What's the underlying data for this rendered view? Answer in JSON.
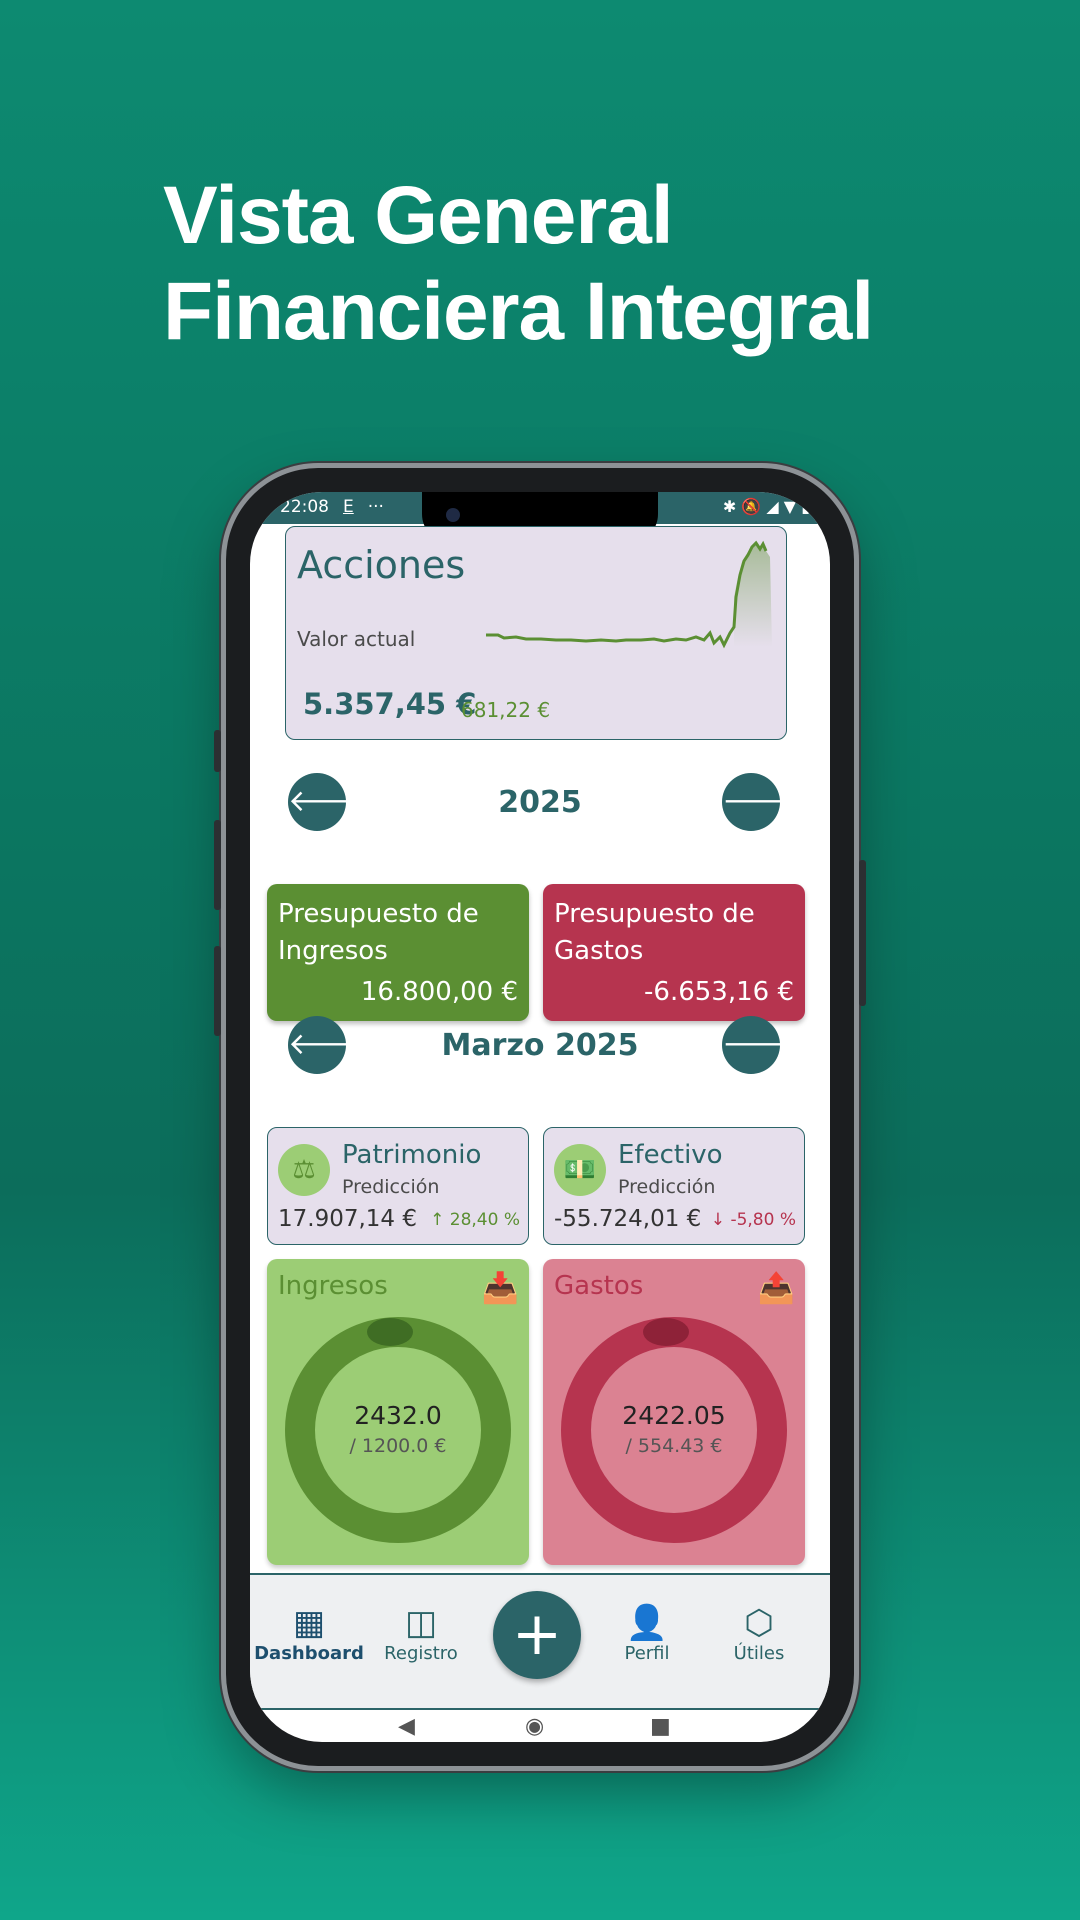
{
  "headline": {
    "line1": "Vista General",
    "line2": "Financiera Integral"
  },
  "status_bar": {
    "time": "22:08",
    "app_icon": "E",
    "more": "···",
    "right_icons": "✱ 🔕 ◢ ▼ ▮"
  },
  "acciones": {
    "title": "Acciones",
    "subtitle": "Valor actual",
    "value": "5.357,45 €",
    "delta": "681,22 €",
    "line_color": "#5b8f33"
  },
  "year_nav": {
    "label": "2025",
    "prev_icon": "arrow-left-icon",
    "next_icon": "arrow-right-icon"
  },
  "budgets": [
    {
      "title": "Presupuesto de Ingresos",
      "value": "16.800,00 €",
      "color": "#5b8f33"
    },
    {
      "title": "Presupuesto de Gastos",
      "value": "-6.653,16 €",
      "color": "#b6344f"
    }
  ],
  "month_nav": {
    "label": "Marzo 2025"
  },
  "kpis": [
    {
      "title": "Patrimonio",
      "subtitle": "Predicción",
      "value": "17.907,14 €",
      "change": "↑ 28,40 %",
      "change_color": "#5b8f33",
      "icon": "scale-icon"
    },
    {
      "title": "Efectivo",
      "subtitle": "Predicción",
      "value": "-55.724,01 €",
      "change": "↓ -5,80 %",
      "change_color": "#b6344f",
      "icon": "cash-icon"
    }
  ],
  "gauges": [
    {
      "title": "Ingresos",
      "main": "2432.0",
      "sub": "/ 1200.0 €",
      "progress": 1.0,
      "bg": "#9ccd75",
      "ring": "#5b8f33",
      "title_color": "#5b8f33"
    },
    {
      "title": "Gastos",
      "main": "2422.05",
      "sub": "/ 554.43 €",
      "progress": 1.0,
      "bg": "#db8292",
      "ring": "#b6344f",
      "title_color": "#b6344f"
    }
  ],
  "bottom_nav": {
    "items": [
      "Dashboard",
      "Registro",
      "Perfil",
      "Útiles"
    ],
    "active": "Dashboard",
    "fab": "+"
  }
}
